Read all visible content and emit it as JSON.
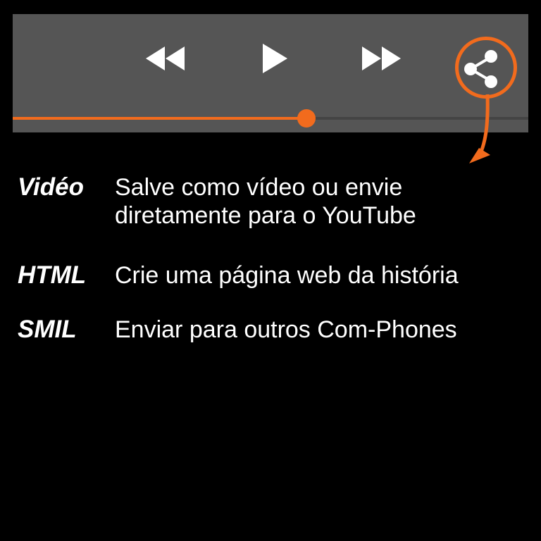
{
  "player": {
    "progress": 0.57,
    "accent_color": "#f26b1d",
    "controls": [
      {
        "icon": "rewind-icon"
      },
      {
        "icon": "play-icon"
      },
      {
        "icon": "fast-forward-icon"
      },
      {
        "icon": "share-icon",
        "highlighted": true
      }
    ]
  },
  "options": [
    {
      "label": "Vidéo",
      "description_lines": [
        "Salve como vídeo ou envie",
        "diretamente para o YouTube"
      ]
    },
    {
      "label": "HTML",
      "description_lines": [
        "Crie uma página web da história"
      ]
    },
    {
      "label": "SMIL",
      "description_lines": [
        "Enviar para outros Com-Phones"
      ]
    }
  ]
}
